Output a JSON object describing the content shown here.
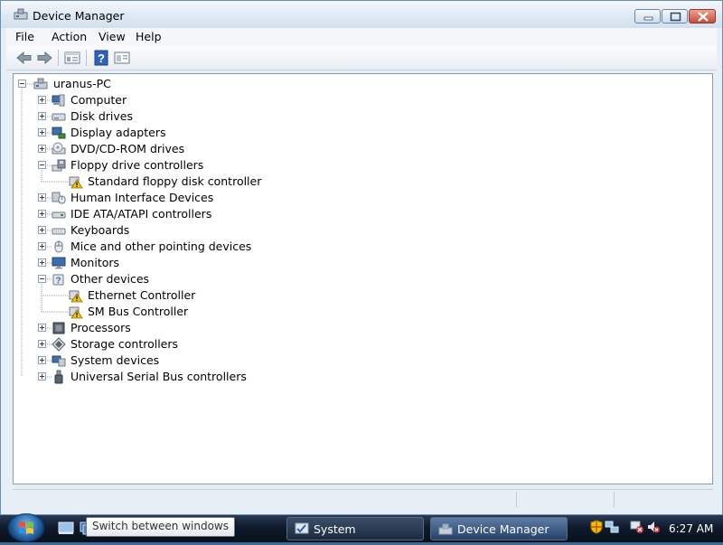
{
  "window": {
    "title": "Device Manager"
  },
  "menu": [
    "File",
    "Action",
    "View",
    "Help"
  ],
  "toolbar": {
    "buttons": [
      "back-icon",
      "forward-icon",
      "properties-icon",
      "help-icon",
      "view-icon"
    ]
  },
  "tree": {
    "root": "uranus-PC",
    "nodes": [
      {
        "label": "Computer",
        "icon": "computer-icon",
        "expanded": false
      },
      {
        "label": "Disk drives",
        "icon": "disk-drive-icon",
        "expanded": false
      },
      {
        "label": "Display adapters",
        "icon": "display-adapter-icon",
        "expanded": false
      },
      {
        "label": "DVD/CD-ROM drives",
        "icon": "dvd-drive-icon",
        "expanded": false
      },
      {
        "label": "Floppy drive controllers",
        "icon": "floppy-controller-icon",
        "expanded": true,
        "children": [
          {
            "label": "Standard floppy disk controller",
            "icon": "warning-device-icon"
          }
        ]
      },
      {
        "label": "Human Interface Devices",
        "icon": "hid-icon",
        "expanded": false
      },
      {
        "label": "IDE ATA/ATAPI controllers",
        "icon": "ide-controller-icon",
        "expanded": false
      },
      {
        "label": "Keyboards",
        "icon": "keyboard-icon",
        "expanded": false
      },
      {
        "label": "Mice and other pointing devices",
        "icon": "mouse-icon",
        "expanded": false
      },
      {
        "label": "Monitors",
        "icon": "monitor-icon",
        "expanded": false
      },
      {
        "label": "Other devices",
        "icon": "unknown-device-icon",
        "expanded": true,
        "children": [
          {
            "label": "Ethernet Controller",
            "icon": "warning-device-icon"
          },
          {
            "label": "SM Bus Controller",
            "icon": "warning-device-icon"
          }
        ]
      },
      {
        "label": "Processors",
        "icon": "processor-icon",
        "expanded": false
      },
      {
        "label": "Storage controllers",
        "icon": "storage-controller-icon",
        "expanded": false
      },
      {
        "label": "System devices",
        "icon": "system-devices-icon",
        "expanded": false
      },
      {
        "label": "Universal Serial Bus controllers",
        "icon": "usb-icon",
        "expanded": false
      }
    ]
  },
  "taskbar": {
    "tooltip": "Switch between windows",
    "tasks": [
      {
        "label": "System",
        "icon": "system-icon",
        "active": false
      },
      {
        "label": "Device Manager",
        "icon": "device-manager-icon",
        "active": true
      }
    ],
    "tray_icons": [
      "security-shield-icon",
      "network-icon",
      "network-disconnected-icon",
      "volume-muted-icon"
    ],
    "clock": "6:27 AM"
  }
}
